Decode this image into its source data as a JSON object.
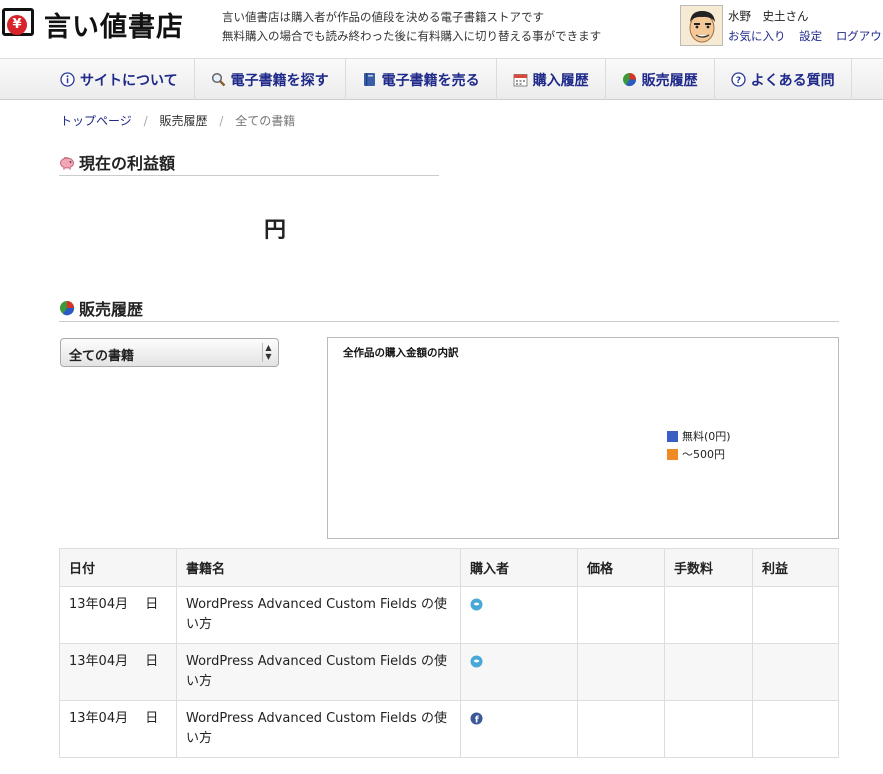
{
  "header": {
    "logo_text": "言い値書店",
    "logo_coin": "¥",
    "tagline_line1": "言い値書店は購入者が作品の値段を決める電子書籍ストアです",
    "tagline_line2": "無料購入の場合でも読み終わった後に有料購入に切り替える事ができます",
    "user_name": "水野　史土さん",
    "links": {
      "favorites": "お気に入り",
      "settings": "設定",
      "logout": "ログアウ"
    }
  },
  "nav": {
    "items": [
      {
        "label": "サイトについて",
        "icon": "info-icon"
      },
      {
        "label": "電子書籍を探す",
        "icon": "magnifier-icon"
      },
      {
        "label": "電子書籍を売る",
        "icon": "book-icon"
      },
      {
        "label": "購入履歴",
        "icon": "calendar-icon"
      },
      {
        "label": "販売履歴",
        "icon": "pie-chart-icon"
      },
      {
        "label": "よくある質問",
        "icon": "question-icon"
      }
    ]
  },
  "breadcrumb": {
    "home": "トップページ",
    "sales": "販売履歴",
    "current": "全ての書籍",
    "separator": "/"
  },
  "profit": {
    "title": "現在の利益額",
    "amount_unit": "円"
  },
  "sales_history": {
    "title": "販売履歴",
    "filter_selected": "全ての書籍"
  },
  "chart_data": {
    "type": "pie",
    "title": "全作品の購入金額の内訳",
    "legend_position": "right",
    "series": [
      {
        "name": "無料(0円)",
        "color": "#3a5fc4"
      },
      {
        "name": "～500円",
        "color": "#f08a24"
      }
    ]
  },
  "table": {
    "headers": [
      "日付",
      "書籍名",
      "購入者",
      "価格",
      "手数料",
      "利益"
    ],
    "rows": [
      {
        "date": "13年04月　 日",
        "title": "WordPress Advanced Custom Fields の使い方",
        "buyer_icon": "twitter-icon"
      },
      {
        "date": "13年04月　 日",
        "title": "WordPress Advanced Custom Fields の使い方",
        "buyer_icon": "twitter-icon"
      },
      {
        "date": "13年04月　 日",
        "title": "WordPress Advanced Custom Fields の使い方",
        "buyer_icon": "facebook-icon"
      }
    ]
  }
}
